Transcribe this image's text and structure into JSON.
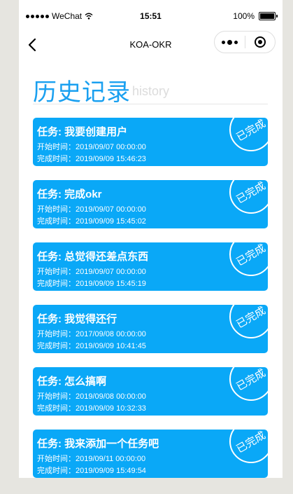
{
  "status_bar": {
    "carrier": "WeChat",
    "time": "15:51",
    "battery": "100%"
  },
  "nav": {
    "title": "KOA-OKR"
  },
  "header": {
    "title_cn": "历史记录",
    "title_en": "history"
  },
  "labels": {
    "task_prefix": "任务: ",
    "start_prefix": "开始时间：",
    "done_prefix": "完成时间：",
    "stamp": "已完成"
  },
  "records": [
    {
      "task": "我要创建用户",
      "start": "2019/09/07 00:00:00",
      "done": "2019/09/09 15:46:23"
    },
    {
      "task": "完成okr",
      "start": "2019/09/07 00:00:00",
      "done": "2019/09/09 15:45:02"
    },
    {
      "task": "总觉得还差点东西",
      "start": "2019/09/07 00:00:00",
      "done": "2019/09/09 15:45:19"
    },
    {
      "task": "我觉得还行",
      "start": "2017/09/08 00:00:00",
      "done": "2019/09/09 10:41:45"
    },
    {
      "task": "怎么搞啊",
      "start": "2019/09/08 00:00:00",
      "done": "2019/09/09 10:32:33"
    },
    {
      "task": "我来添加一个任务吧",
      "start": "2019/09/11 00:00:00",
      "done": "2019/09/09 15:49:54"
    }
  ],
  "colors": {
    "accent": "#1aa0f0",
    "card": "#0aa8f7",
    "background": "#e6e5e0"
  }
}
